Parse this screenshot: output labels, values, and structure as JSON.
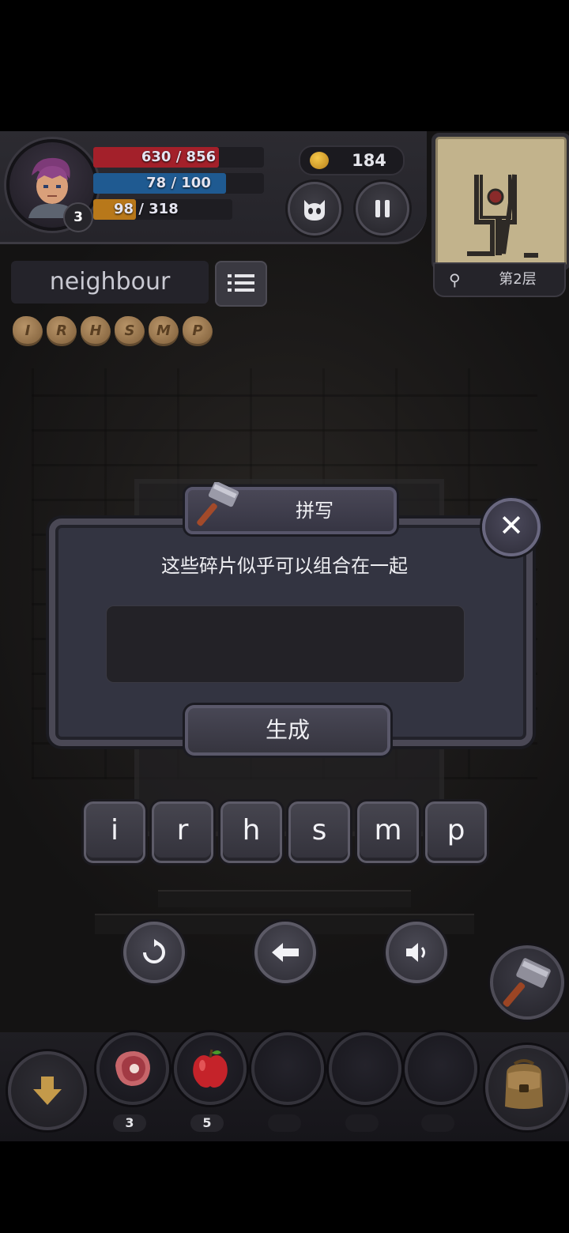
{
  "hud": {
    "hp": "630 / 856",
    "hp_fraction": 0.736,
    "mp": "78 / 100",
    "mp_fraction": 0.78,
    "xp": "98 / 318",
    "xp_fraction": 0.308,
    "level": "3",
    "gold": "184",
    "floor": "第2层",
    "colors": {
      "hp": "#a3202a",
      "mp": "#1f5a91",
      "xp": "#b8781a"
    }
  },
  "word": {
    "current": "neighbour",
    "fragments": [
      "I",
      "R",
      "H",
      "S",
      "M",
      "P"
    ]
  },
  "dialog": {
    "title": "拼写",
    "prompt": "这些碎片似乎可以组合在一起",
    "input_value": "",
    "generate_label": "生成",
    "close_label": "✕"
  },
  "letters": [
    "i",
    "r",
    "h",
    "s",
    "m",
    "p"
  ],
  "controls": [
    "reset-icon",
    "backspace-icon",
    "speaker-icon"
  ],
  "inventory": {
    "slots": [
      {
        "item": "meat-icon",
        "count": "3"
      },
      {
        "item": "apple-icon",
        "count": "5"
      },
      {
        "item": "",
        "count": ""
      },
      {
        "item": "",
        "count": ""
      },
      {
        "item": "",
        "count": ""
      }
    ]
  }
}
